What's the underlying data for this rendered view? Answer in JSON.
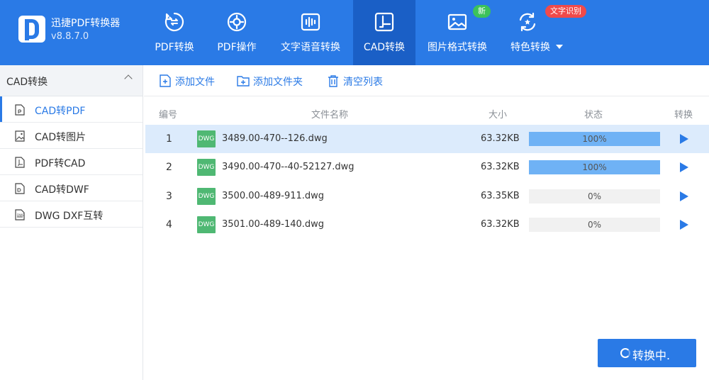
{
  "app": {
    "name": "迅捷PDF转换器",
    "version": "v8.8.7.0"
  },
  "nav": [
    {
      "id": "pdf-convert",
      "label": "PDF转换",
      "icon": "pdf-convert-icon"
    },
    {
      "id": "pdf-ops",
      "label": "PDF操作",
      "icon": "gear-doc-icon"
    },
    {
      "id": "text-voice",
      "label": "文字语音转换",
      "icon": "audio-wave-icon"
    },
    {
      "id": "cad-convert",
      "label": "CAD转换",
      "icon": "cad-icon",
      "active": true
    },
    {
      "id": "image-format",
      "label": "图片格式转换",
      "icon": "image-icon",
      "badge": "新"
    },
    {
      "id": "special",
      "label": "特色转换",
      "icon": "refresh-icon",
      "badge": "文字识别"
    }
  ],
  "sidebar": {
    "header": "CAD转换",
    "items": [
      {
        "label": "CAD转PDF",
        "active": true,
        "icon": "pdf-file-icon"
      },
      {
        "label": "CAD转图片",
        "icon": "image-file-icon"
      },
      {
        "label": "PDF转CAD",
        "icon": "cad-file-icon"
      },
      {
        "label": "CAD转DWF",
        "icon": "dwf-file-icon"
      },
      {
        "label": "DWG DXF互转",
        "icon": "dwg-file-icon"
      }
    ]
  },
  "toolbar": {
    "add_file": "添加文件",
    "add_folder": "添加文件夹",
    "clear_list": "清空列表"
  },
  "table": {
    "headers": {
      "num": "编号",
      "name": "文件名称",
      "size": "大小",
      "status": "状态",
      "convert": "转换"
    },
    "rows": [
      {
        "num": "1",
        "type": "DWG",
        "name": "3489.00-470--126.dwg",
        "size": "63.32KB",
        "progress": 100,
        "progress_text": "100%",
        "selected": true
      },
      {
        "num": "2",
        "type": "DWG",
        "name": "3490.00-470--40-52127.dwg",
        "size": "63.32KB",
        "progress": 100,
        "progress_text": "100%"
      },
      {
        "num": "3",
        "type": "DWG",
        "name": "3500.00-489-911.dwg",
        "size": "63.35KB",
        "progress": 0,
        "progress_text": "0%"
      },
      {
        "num": "4",
        "type": "DWG",
        "name": "3501.00-489-140.dwg",
        "size": "63.32KB",
        "progress": 0,
        "progress_text": "0%"
      }
    ]
  },
  "convert_button": {
    "label": "转换中."
  },
  "colors": {
    "primary": "#2a7ae6",
    "active_nav": "#1a5fc6",
    "progress": "#6fb2f5",
    "dwg": "#4fb873",
    "badge_new": "#3cc25a",
    "badge_ocr": "#f04a4a"
  }
}
